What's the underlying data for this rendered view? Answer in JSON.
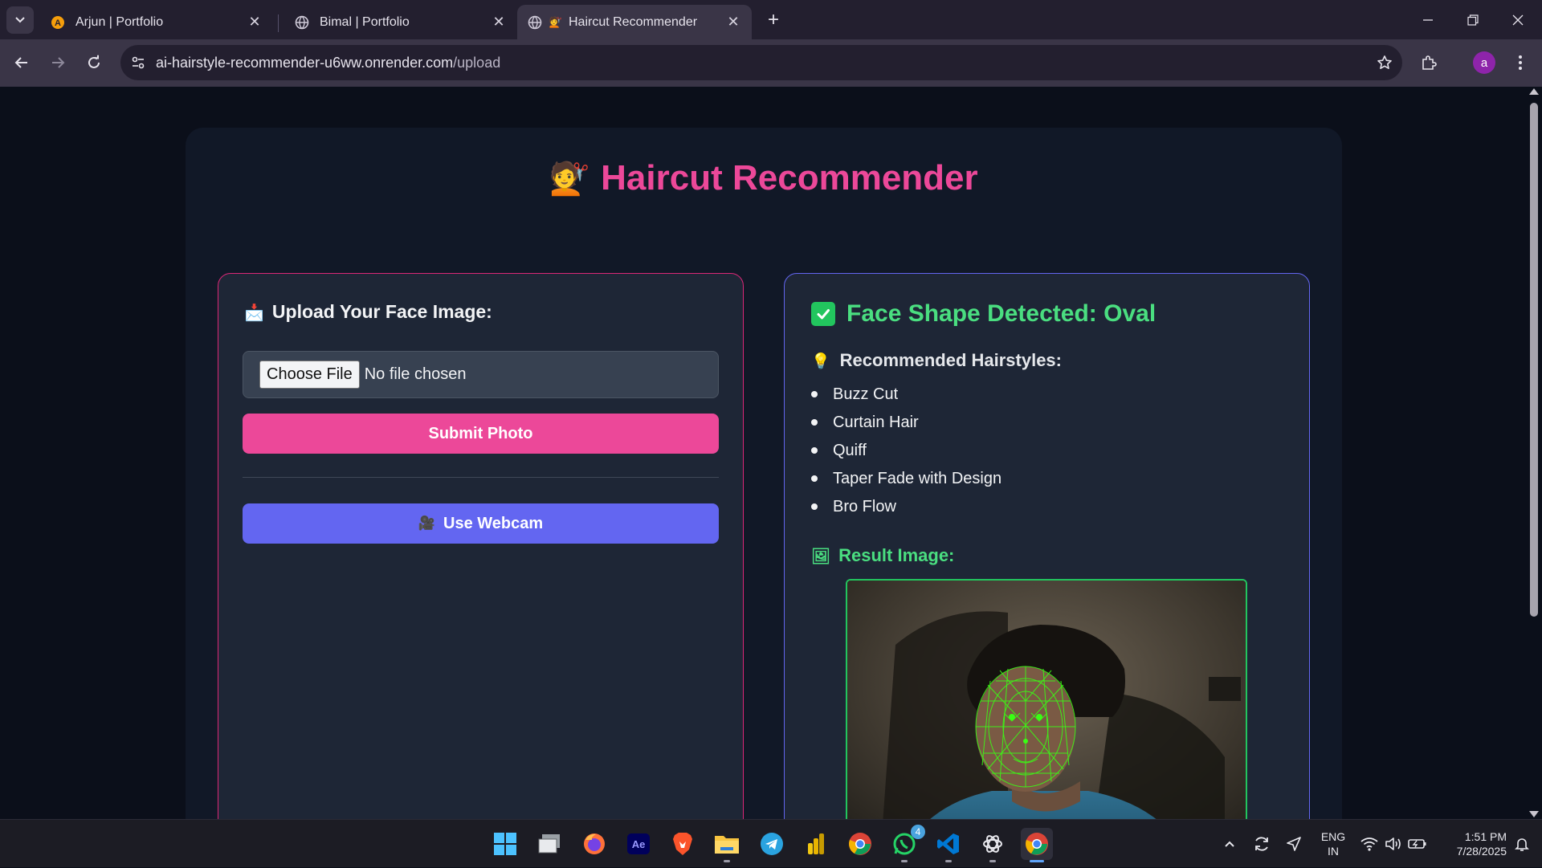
{
  "browser": {
    "tabs": [
      {
        "title": "Arjun | Portfolio",
        "active": false
      },
      {
        "title": "Bimal | Portfolio",
        "active": false
      },
      {
        "title": "Haircut Recommender",
        "active": true
      }
    ],
    "url_host": "ai-hairstyle-recommender-u6ww.onrender.com",
    "url_path": "/upload",
    "profile_initial": "a"
  },
  "page": {
    "title": "Haircut Recommender",
    "title_emoji": "💇",
    "upload": {
      "heading": "Upload Your Face Image:",
      "heading_emoji": "📩",
      "choose_file_label": "Choose File",
      "file_status": "No file chosen",
      "submit_label": "Submit Photo",
      "webcam_label": "Use Webcam",
      "webcam_emoji": "🎥"
    },
    "result": {
      "face_shape_heading": "Face Shape Detected: Oval",
      "recommended_heading": "Recommended Hairstyles:",
      "recommended_emoji": "💡",
      "hairstyles": [
        "Buzz Cut",
        "Curtain Hair",
        "Quiff",
        "Taper Fade with Design",
        "Bro Flow"
      ],
      "result_image_heading": "Result Image:",
      "result_image_emoji": "🖼"
    },
    "colors": {
      "accent_pink": "#ec4899",
      "accent_indigo": "#6366f1",
      "success_green": "#4ade80"
    }
  },
  "taskbar": {
    "whatsapp_badge": "4",
    "lang_line1": "ENG",
    "lang_line2": "IN",
    "time": "1:51 PM",
    "date": "7/28/2025"
  }
}
